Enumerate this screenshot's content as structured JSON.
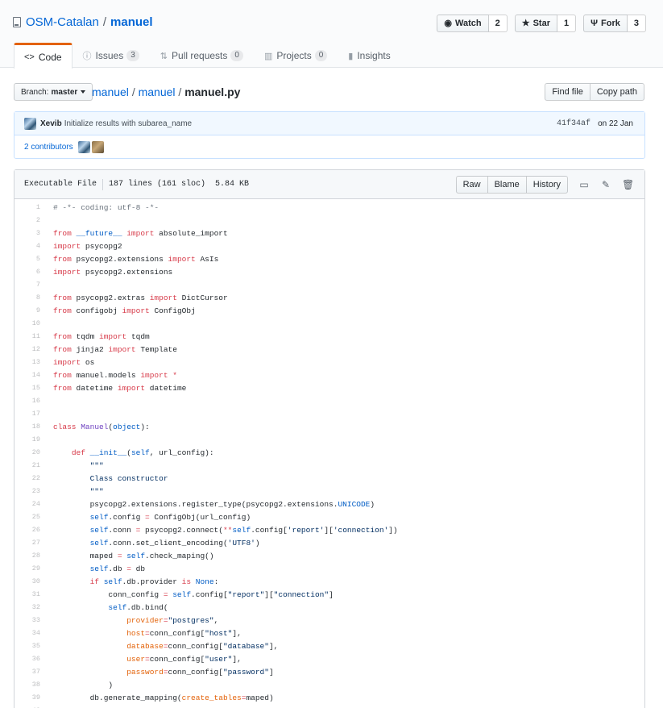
{
  "repo": {
    "owner": "OSM-Catalan",
    "name": "manuel"
  },
  "actions": [
    {
      "label": "Watch",
      "icon": "eye-icon",
      "count": "2"
    },
    {
      "label": "Star",
      "icon": "star-icon",
      "count": "1"
    },
    {
      "label": "Fork",
      "icon": "fork-icon",
      "count": "3"
    }
  ],
  "tabs": [
    {
      "label": "Code",
      "icon": "code-icon",
      "counter": null
    },
    {
      "label": "Issues",
      "icon": "issue-icon",
      "counter": "3"
    },
    {
      "label": "Pull requests",
      "icon": "pull-request-icon",
      "counter": "0"
    },
    {
      "label": "Projects",
      "icon": "project-icon",
      "counter": "0"
    },
    {
      "label": "Insights",
      "icon": "graph-icon",
      "counter": null
    }
  ],
  "branch": {
    "prefix": "Branch:",
    "name": "master"
  },
  "breadcrumb": {
    "root": "manuel",
    "dir": "manuel",
    "file": "manuel.py"
  },
  "path_buttons": {
    "find": "Find file",
    "copy": "Copy path"
  },
  "commit": {
    "author": "Xevib",
    "message": "Initialize results with subarea_name",
    "sha": "41f34af",
    "date": "on 22 Jan"
  },
  "contributors": {
    "label": "2 contributors"
  },
  "file": {
    "mode": "Executable File",
    "lines": "187 lines (161 sloc)",
    "size": "5.84 KB",
    "buttons": {
      "raw": "Raw",
      "blame": "Blame",
      "history": "History"
    }
  },
  "code_lines": [
    [
      [
        "c",
        "# -*- coding: utf-8 -*-"
      ]
    ],
    [],
    [
      [
        "k",
        "from"
      ],
      [
        "",
        " "
      ],
      [
        "v",
        "__future__"
      ],
      [
        "",
        " "
      ],
      [
        "k",
        "import"
      ],
      [
        "",
        " absolute_import"
      ]
    ],
    [
      [
        "k",
        "import"
      ],
      [
        "",
        " psycopg2"
      ]
    ],
    [
      [
        "k",
        "from"
      ],
      [
        "",
        " psycopg2.extensions "
      ],
      [
        "k",
        "import"
      ],
      [
        "",
        " AsIs"
      ]
    ],
    [
      [
        "k",
        "import"
      ],
      [
        "",
        " psycopg2.extensions"
      ]
    ],
    [],
    [
      [
        "k",
        "from"
      ],
      [
        "",
        " psycopg2.extras "
      ],
      [
        "k",
        "import"
      ],
      [
        "",
        " DictCursor"
      ]
    ],
    [
      [
        "k",
        "from"
      ],
      [
        "",
        " configobj "
      ],
      [
        "k",
        "import"
      ],
      [
        "",
        " ConfigObj"
      ]
    ],
    [],
    [
      [
        "k",
        "from"
      ],
      [
        "",
        " tqdm "
      ],
      [
        "k",
        "import"
      ],
      [
        "",
        " tqdm"
      ]
    ],
    [
      [
        "k",
        "from"
      ],
      [
        "",
        " jinja2 "
      ],
      [
        "k",
        "import"
      ],
      [
        "",
        " Template"
      ]
    ],
    [
      [
        "k",
        "import"
      ],
      [
        "",
        " os"
      ]
    ],
    [
      [
        "k",
        "from"
      ],
      [
        "",
        " manuel.models "
      ],
      [
        "k",
        "import"
      ],
      [
        "",
        " "
      ],
      [
        "k",
        "*"
      ]
    ],
    [
      [
        "k",
        "from"
      ],
      [
        "",
        " datetime "
      ],
      [
        "k",
        "import"
      ],
      [
        "",
        " datetime"
      ]
    ],
    [],
    [],
    [
      [
        "k",
        "class"
      ],
      [
        "",
        " "
      ],
      [
        "e",
        "Manuel"
      ],
      [
        "",
        "("
      ],
      [
        "v",
        "object"
      ],
      [
        "",
        "):"
      ]
    ],
    [],
    [
      [
        "",
        "    "
      ],
      [
        "k",
        "def"
      ],
      [
        "",
        " "
      ],
      [
        "v",
        "__init__"
      ],
      [
        "",
        "("
      ],
      [
        "v",
        "self"
      ],
      [
        "",
        ", url_config):"
      ]
    ],
    [
      [
        "s",
        "        \"\"\""
      ]
    ],
    [
      [
        "s",
        "        Class constructor"
      ]
    ],
    [
      [
        "s",
        "        \"\"\""
      ]
    ],
    [
      [
        "",
        "        psycopg2.extensions.register_type(psycopg2.extensions."
      ],
      [
        "v",
        "UNICODE"
      ],
      [
        "",
        ")"
      ]
    ],
    [
      [
        "",
        "        "
      ],
      [
        "v",
        "self"
      ],
      [
        "",
        ".config "
      ],
      [
        "k",
        "="
      ],
      [
        "",
        " ConfigObj(url_config)"
      ]
    ],
    [
      [
        "",
        "        "
      ],
      [
        "v",
        "self"
      ],
      [
        "",
        ".conn "
      ],
      [
        "k",
        "="
      ],
      [
        "",
        " psycopg2.connect("
      ],
      [
        "k",
        "**"
      ],
      [
        "v",
        "self"
      ],
      [
        "",
        ".config["
      ],
      [
        "s",
        "'report'"
      ],
      [
        "",
        "]["
      ],
      [
        "s",
        "'connection'"
      ],
      [
        "",
        "])"
      ]
    ],
    [
      [
        "",
        "        "
      ],
      [
        "v",
        "self"
      ],
      [
        "",
        ".conn.set_client_encoding("
      ],
      [
        "s",
        "'UTF8'"
      ],
      [
        "",
        ")"
      ]
    ],
    [
      [
        "",
        "        maped "
      ],
      [
        "k",
        "="
      ],
      [
        "",
        " "
      ],
      [
        "v",
        "self"
      ],
      [
        "",
        ".check_maping()"
      ]
    ],
    [
      [
        "",
        "        "
      ],
      [
        "v",
        "self"
      ],
      [
        "",
        ".db "
      ],
      [
        "k",
        "="
      ],
      [
        "",
        " db"
      ]
    ],
    [
      [
        "",
        "        "
      ],
      [
        "k",
        "if"
      ],
      [
        "",
        " "
      ],
      [
        "v",
        "self"
      ],
      [
        "",
        ".db.provider "
      ],
      [
        "k",
        "is"
      ],
      [
        "",
        " "
      ],
      [
        "v",
        "None"
      ],
      [
        "",
        ":"
      ]
    ],
    [
      [
        "",
        "            conn_config "
      ],
      [
        "k",
        "="
      ],
      [
        "",
        " "
      ],
      [
        "v",
        "self"
      ],
      [
        "",
        ".config["
      ],
      [
        "s",
        "\"report\""
      ],
      [
        "",
        "]["
      ],
      [
        "s",
        "\"connection\""
      ],
      [
        "",
        "]"
      ]
    ],
    [
      [
        "",
        "            "
      ],
      [
        "v",
        "self"
      ],
      [
        "",
        ".db.bind("
      ]
    ],
    [
      [
        "",
        "                "
      ],
      [
        "u",
        "provider"
      ],
      [
        "k",
        "="
      ],
      [
        "s",
        "\"postgres\""
      ],
      [
        "",
        ","
      ]
    ],
    [
      [
        "",
        "                "
      ],
      [
        "u",
        "host"
      ],
      [
        "k",
        "="
      ],
      [
        "",
        "conn_config["
      ],
      [
        "s",
        "\"host\""
      ],
      [
        "",
        "],"
      ]
    ],
    [
      [
        "",
        "                "
      ],
      [
        "u",
        "database"
      ],
      [
        "k",
        "="
      ],
      [
        "",
        "conn_config["
      ],
      [
        "s",
        "\"database\""
      ],
      [
        "",
        "],"
      ]
    ],
    [
      [
        "",
        "                "
      ],
      [
        "u",
        "user"
      ],
      [
        "k",
        "="
      ],
      [
        "",
        "conn_config["
      ],
      [
        "s",
        "\"user\""
      ],
      [
        "",
        "],"
      ]
    ],
    [
      [
        "",
        "                "
      ],
      [
        "u",
        "password"
      ],
      [
        "k",
        "="
      ],
      [
        "",
        "conn_config["
      ],
      [
        "s",
        "\"password\""
      ],
      [
        "",
        "]"
      ]
    ],
    [
      [
        "",
        "            )"
      ]
    ],
    [
      [
        "",
        "        db.generate_mapping("
      ],
      [
        "u",
        "create_tables"
      ],
      [
        "k",
        "="
      ],
      [
        "",
        "maped)"
      ]
    ],
    []
  ]
}
